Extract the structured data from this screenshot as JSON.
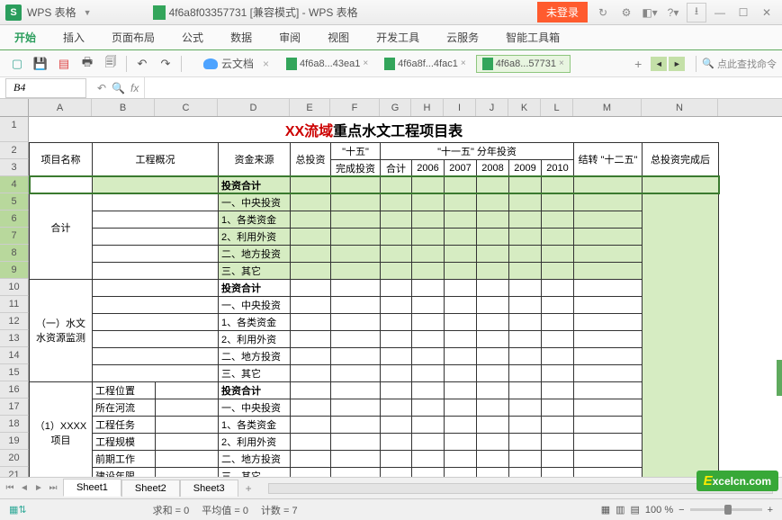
{
  "title_bar": {
    "app_logo": "S",
    "app_name": "WPS 表格",
    "doc_title": "4f6a8f03357731 [兼容模式] - WPS 表格",
    "not_logged_in": "未登录"
  },
  "menu": {
    "items": [
      "开始",
      "插入",
      "页面布局",
      "公式",
      "数据",
      "审阅",
      "视图",
      "开发工具",
      "云服务",
      "智能工具箱"
    ]
  },
  "toolbar": {
    "cloud_doc": "云文档",
    "file_tabs": [
      {
        "label": "4f6a8...43ea1",
        "active": false
      },
      {
        "label": "4f6a8f...4fac1",
        "active": false
      },
      {
        "label": "4f6a8...57731",
        "active": true
      }
    ],
    "search_placeholder": "点此查找命令"
  },
  "formula_bar": {
    "cell_name": "B4"
  },
  "columns": [
    "A",
    "B",
    "C",
    "D",
    "E",
    "F",
    "G",
    "H",
    "I",
    "J",
    "K",
    "L",
    "M",
    "N"
  ],
  "rows": [
    "1",
    "2",
    "3",
    "4",
    "5",
    "6",
    "7",
    "8",
    "9",
    "10",
    "11",
    "12",
    "13",
    "14",
    "15",
    "16",
    "17",
    "18",
    "19",
    "20",
    "21"
  ],
  "sheet": {
    "title_red": "XX流域",
    "title_black": "重点水文工程项目表",
    "headers": {
      "project_name": "项目名称",
      "project_overview": "工程概况",
      "fund_source": "资金来源",
      "total_invest": "总投资",
      "fifteen": "\"十五\"",
      "fifteen_complete": "完成投资",
      "eleven_five": "\"十一五\" 分年投资",
      "subtotal": "合计",
      "y2006": "2006",
      "y2007": "2007",
      "y2008": "2008",
      "y2009": "2009",
      "y2010": "2010",
      "carry_twelve": "结转 \"十二五\"",
      "total_complete": "总投资完成后"
    },
    "sections": {
      "heji": "合计",
      "section1": "（一）水文水资源监测",
      "section2": "（1）XXXX项目"
    },
    "fund_rows": {
      "invest_total": "投资合计",
      "central": "一、中央投资",
      "various": "1、各类资金",
      "foreign": "2、利用外资",
      "local": "二、地方投资",
      "other": "三、其它"
    },
    "overview_labels": {
      "location": "工程位置",
      "river": "所在河流",
      "task": "工程任务",
      "scale": "工程规模",
      "prep": "前期工作",
      "duration": "建设年限"
    }
  },
  "sheet_tabs": [
    "Sheet1",
    "Sheet2",
    "Sheet3"
  ],
  "status_bar": {
    "sum": "求和 = 0",
    "avg": "平均值 = 0",
    "count": "计数 = 7",
    "zoom": "100 %"
  },
  "watermark": "xcelcn.com",
  "chart_data": null
}
